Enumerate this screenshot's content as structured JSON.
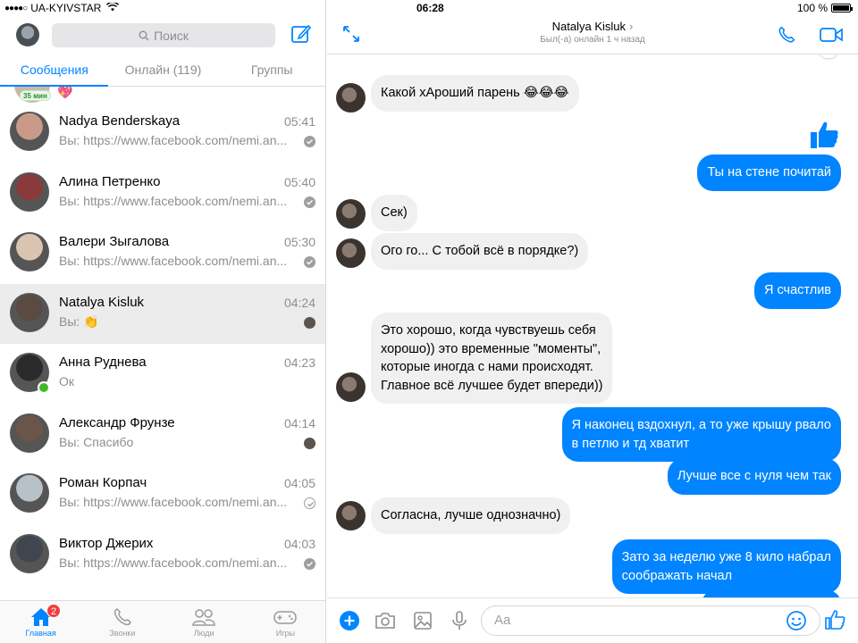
{
  "status_bar": {
    "carrier": "UA-KYIVSTAR",
    "time": "06:28",
    "battery": "100 %"
  },
  "sidebar": {
    "search_placeholder": "Поиск",
    "tabs": [
      {
        "label": "Сообщения",
        "active": true
      },
      {
        "label": "Онлайн (119)",
        "active": false
      },
      {
        "label": "Группы",
        "active": false
      }
    ],
    "peek": {
      "badge": "35 мин"
    },
    "conversations": [
      {
        "name": "Nadya Benderskaya",
        "time": "05:41",
        "preview": "Вы: https://www.facebook.com/nemi.an...",
        "status": "sent",
        "avatar_color": "#c99a8a",
        "online": false,
        "selected": false
      },
      {
        "name": "Алина Петренко",
        "time": "05:40",
        "preview": "Вы: https://www.facebook.com/nemi.an...",
        "status": "sent",
        "avatar_color": "#8a3a3a",
        "online": false,
        "selected": false
      },
      {
        "name": "Валери Зыгалова",
        "time": "05:30",
        "preview": "Вы: https://www.facebook.com/nemi.an...",
        "status": "sent",
        "avatar_color": "#d8c4b0",
        "online": false,
        "selected": false
      },
      {
        "name": "Natalya Kisluk",
        "time": "04:24",
        "preview": "Вы: 👏",
        "status": "seen",
        "avatar_color": "#5a4a42",
        "online": false,
        "selected": true
      },
      {
        "name": "Анна Руднева",
        "time": "04:23",
        "preview": "Ок",
        "status": "none",
        "avatar_color": "#2a2a2a",
        "online": true,
        "selected": false
      },
      {
        "name": "Александр Фрунзе",
        "time": "04:14",
        "preview": "Вы: Спасибо",
        "status": "seen",
        "avatar_color": "#6a5548",
        "online": false,
        "selected": false
      },
      {
        "name": "Роман Корпач",
        "time": "04:05",
        "preview": "Вы: https://www.facebook.com/nemi.an...",
        "status": "sent-outline",
        "avatar_color": "#b7c2c8",
        "online": false,
        "selected": false
      },
      {
        "name": "Виктор Джерих",
        "time": "04:03",
        "preview": "Вы: https://www.facebook.com/nemi.an...",
        "status": "sent",
        "avatar_color": "#3f4650",
        "online": false,
        "selected": false
      }
    ],
    "bottom_nav": [
      {
        "label": "Главная",
        "icon": "home-icon",
        "active": true,
        "badge": "2"
      },
      {
        "label": "Звонки",
        "icon": "phone-icon",
        "active": false,
        "badge": ""
      },
      {
        "label": "Люди",
        "icon": "people-icon",
        "active": false,
        "badge": ""
      },
      {
        "label": "Игры",
        "icon": "gamepad-icon",
        "active": false,
        "badge": ""
      }
    ]
  },
  "chat": {
    "title": "Natalya Kisluk",
    "subtitle": "Был(-а) онлайн 1 ч назад",
    "messages": [
      {
        "dir": "in",
        "text": "Какой хАроший парень 😂😂😂",
        "avatar": true
      },
      {
        "dir": "out",
        "text": "Ты на стене почитай"
      },
      {
        "dir": "in",
        "text": "Сек)",
        "avatar": true
      },
      {
        "dir": "in",
        "text": "Ого го... С тобой всё в порядке?)",
        "avatar": true
      },
      {
        "dir": "out",
        "text": "Я счастлив"
      },
      {
        "dir": "in",
        "text": "Это хорошо, когда чувствуешь себя\nхорошо)) это временные \"моменты\",\nкоторые иногда с нами происходят.\nГлавное всё лучшее будет впереди))",
        "avatar": true
      },
      {
        "dir": "out",
        "text": "Я наконец вздохнул, а то уже крышу рвало\nв петлю и тд хватит"
      },
      {
        "dir": "out",
        "text": "Лучше все с нуля чем так"
      },
      {
        "dir": "in",
        "text": "Согласна, лучше однозначно)",
        "avatar": true
      },
      {
        "dir": "out",
        "text": "Зато за неделю уже 8 кило набрал\nсоображать начал"
      }
    ],
    "composer": {
      "placeholder": "Aa"
    },
    "accent_color": "#0084ff"
  }
}
